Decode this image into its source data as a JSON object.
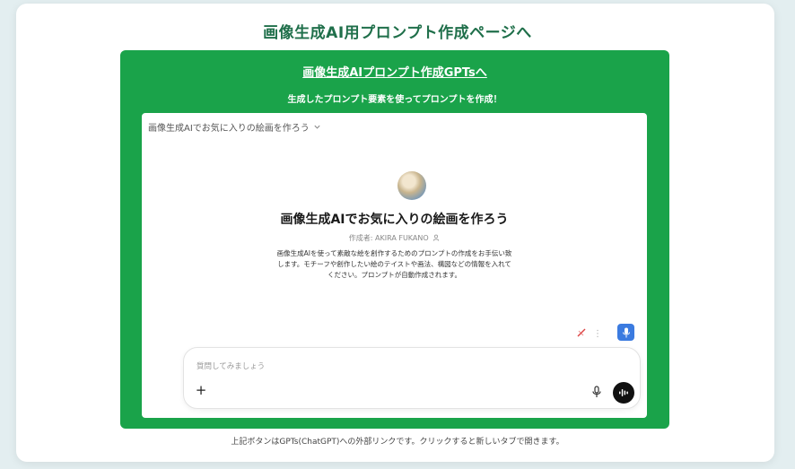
{
  "page": {
    "title": "画像生成AI用プロンプト作成ページへ",
    "footnote": "上記ボタンはGPTs(ChatGPT)への外部リンクです。クリックすると新しいタブで開きます。"
  },
  "banner": {
    "link_label": "画像生成AIプロンプト作成GPTsへ",
    "subtitle": "生成したプロンプト要素を使ってプロンプトを作成！",
    "background_color": "#1aa34a"
  },
  "chat": {
    "header_title": "画像生成AIでお気に入りの絵画を作ろう",
    "header_chevron_icon": "chevron-down-icon",
    "gpt_name": "画像生成AIでお気に入りの絵画を作ろう",
    "author": "作成者: AKIRA FUKANO",
    "author_icon": "person-icon",
    "description": "画像生成AIを使って素敵な絵を創作するためのプロンプトの作成をお手伝い致します。モチーフや創作したい絵のテイストや画法、構図などの情報を入れてください。プロンプトが自動作成されます。",
    "composer": {
      "placeholder": "質問してみましょう",
      "value": ""
    }
  },
  "colors": {
    "title": "#1f6f4a",
    "mic_button": "#3b7be0",
    "voice_button": "#111111"
  }
}
